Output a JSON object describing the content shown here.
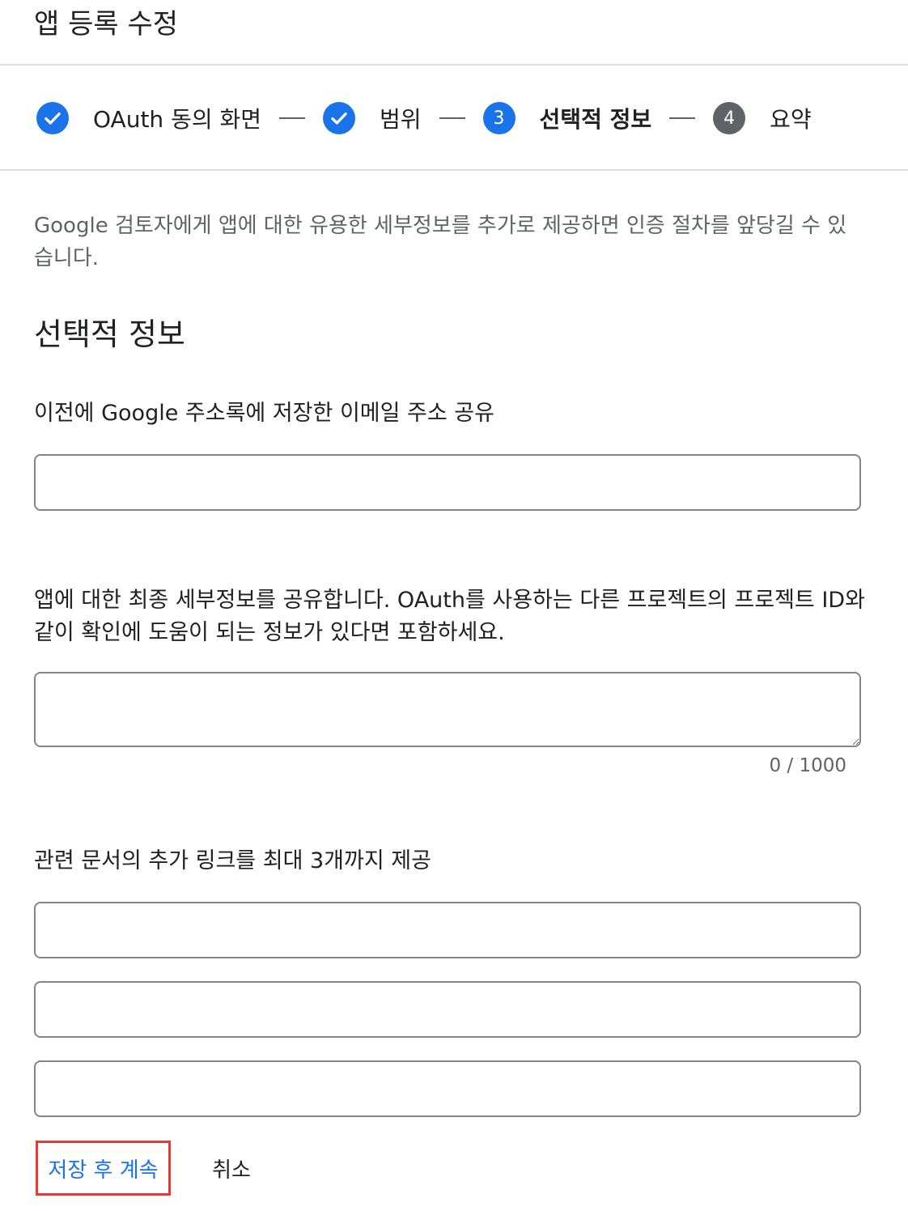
{
  "header": {
    "title": "앱 등록 수정"
  },
  "stepper": {
    "steps": [
      {
        "label": "OAuth 동의 화면",
        "state": "done",
        "number": ""
      },
      {
        "label": "범위",
        "state": "done",
        "number": ""
      },
      {
        "label": "선택적 정보",
        "state": "current",
        "number": "3"
      },
      {
        "label": "요약",
        "state": "pending",
        "number": "4"
      }
    ]
  },
  "intro": "Google 검토자에게 앱에 대한 유용한 세부정보를 추가로 제공하면 인증 절차를 앞당길 수 있습니다.",
  "section": {
    "title": "선택적 정보"
  },
  "fields": {
    "email_share": {
      "label": "이전에 Google 주소록에 저장한 이메일 주소 공유",
      "value": ""
    },
    "details": {
      "label": "앱에 대한 최종 세부정보를 공유합니다. OAuth를 사용하는 다른 프로젝트의 프로젝트 ID와 같이 확인에 도움이 되는 정보가 있다면 포함하세요.",
      "value": "",
      "counter": "0 / 1000"
    },
    "links": {
      "label": "관련 문서의 추가 링크를 최대 3개까지 제공",
      "values": [
        "",
        "",
        ""
      ]
    }
  },
  "actions": {
    "save_continue": "저장 후 계속",
    "cancel": "취소"
  },
  "colors": {
    "accent": "#1a73e8",
    "pending_step": "#5f6368",
    "highlight_border": "#e53935"
  }
}
